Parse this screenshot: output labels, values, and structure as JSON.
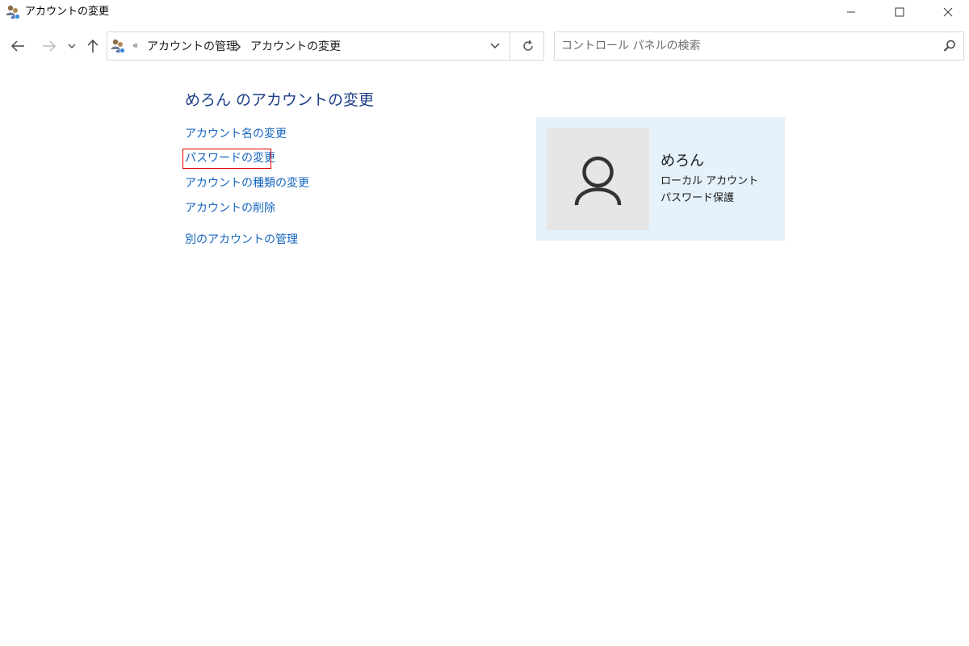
{
  "window": {
    "title": "アカウントの変更",
    "app_icon": "user-accounts-icon",
    "controls": [
      "minimize-icon",
      "maximize-icon",
      "close-icon"
    ]
  },
  "navigation": {
    "back_icon": "back-arrow-icon",
    "forward_icon": "forward-arrow-icon",
    "recent_icon": "chevron-down-icon",
    "up_icon": "up-arrow-icon",
    "address": {
      "icon": "user-accounts-icon",
      "overflow": "«",
      "breadcrumbs": [
        "アカウントの管理",
        "アカウントの変更"
      ],
      "dropdown_icon": "chevron-down-icon",
      "refresh_icon": "refresh-icon"
    },
    "search": {
      "placeholder": "コントロール パネルの検索",
      "value": "",
      "icon": "search-icon"
    }
  },
  "main": {
    "title": "めろん のアカウントの変更",
    "links": [
      "アカウント名の変更",
      "パスワードの変更",
      "アカウントの種類の変更",
      "アカウントの削除",
      "別のアカウントの管理"
    ],
    "highlighted_link": "パスワードの変更",
    "link_color": "#1565c0",
    "title_color": "#1e3f8a",
    "highlight_color": "#e00000"
  },
  "account": {
    "name": "めろん",
    "type": "ローカル アカウント",
    "status": "パスワード保護",
    "avatar_icon": "user-silhouette-icon",
    "card_color": "#e5f1fb"
  }
}
